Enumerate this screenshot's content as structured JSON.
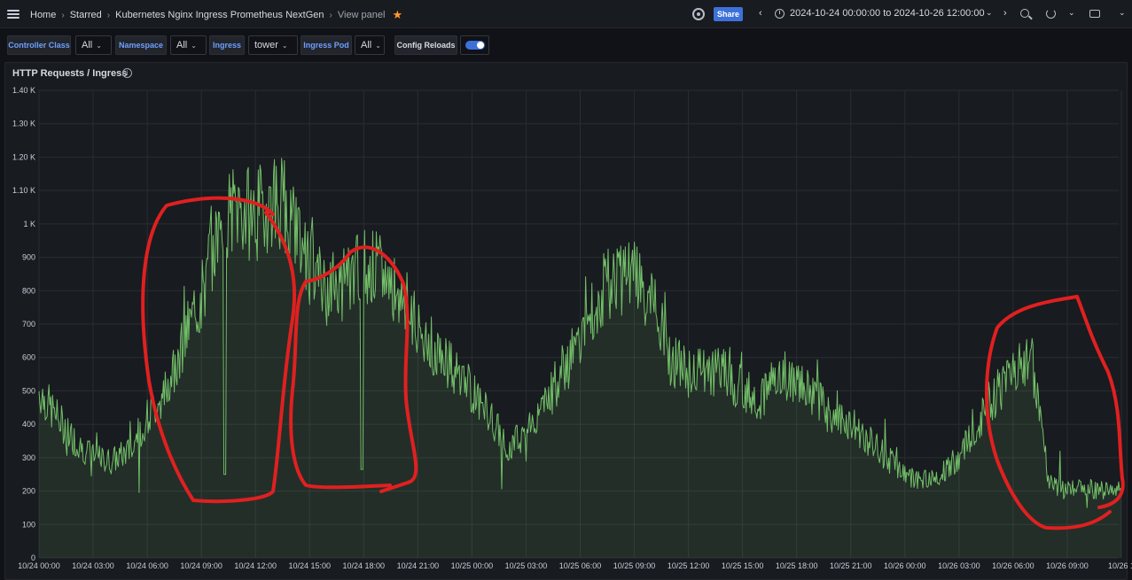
{
  "topbar": {
    "breadcrumbs": [
      "Home",
      "Starred",
      "Kubernetes Nginx Ingress Prometheus NextGen",
      "View panel"
    ],
    "share_label": "Share",
    "time_range": "2024-10-24 00:00:00 to 2024-10-26 12:00:00",
    "icons": [
      "menu-icon",
      "star-icon",
      "gear-icon",
      "time-back-icon",
      "clock-icon",
      "chevron-down-icon",
      "time-forward-icon",
      "zoom-out-icon",
      "refresh-icon",
      "chevron-down-icon",
      "tv-icon",
      "chevron-down-icon"
    ]
  },
  "variables": [
    {
      "label": "Controller Class",
      "value": "All"
    },
    {
      "label": "Namespace",
      "value": "All"
    },
    {
      "label": "Ingress",
      "value": "tower"
    },
    {
      "label": "Ingress Pod",
      "value": "All"
    },
    {
      "label": "Config Reloads",
      "toggle": true
    }
  ],
  "panel": {
    "title": "HTTP Requests / Ingress"
  },
  "colors": {
    "series": "#73bf69",
    "annotation": "#e02020",
    "accent": "#3d71d9",
    "star": "#ff9830"
  },
  "chart_data": {
    "type": "line",
    "title": "HTTP Requests / Ingress",
    "y_ticks": [
      "0",
      "100",
      "200",
      "300",
      "400",
      "500",
      "600",
      "700",
      "800",
      "900",
      "1 K",
      "1.10 K",
      "1.20 K",
      "1.30 K",
      "1.40 K"
    ],
    "ylim": [
      0,
      1400
    ],
    "x_ticks": [
      "10/24 00:00",
      "10/24 03:00",
      "10/24 06:00",
      "10/24 09:00",
      "10/24 12:00",
      "10/24 15:00",
      "10/24 18:00",
      "10/24 21:00",
      "10/25 00:00",
      "10/25 03:00",
      "10/25 06:00",
      "10/25 09:00",
      "10/25 12:00",
      "10/25 15:00",
      "10/25 18:00",
      "10/25 21:00",
      "10/26 00:00",
      "10/26 03:00",
      "10/26 06:00",
      "10/26 09:00",
      "10/26 1"
    ],
    "x_hours": [
      0,
      1,
      2,
      3,
      4,
      5,
      6,
      7,
      8,
      9,
      10,
      11,
      12,
      13,
      14,
      15,
      16,
      17,
      18,
      19,
      20,
      21,
      22,
      23,
      24,
      25,
      26,
      27,
      28,
      29,
      30,
      31,
      32,
      33,
      34,
      35,
      36,
      37,
      38,
      39,
      40,
      41,
      42,
      43,
      44,
      45,
      46,
      47,
      48,
      49,
      50,
      51,
      52,
      53,
      54,
      55,
      56,
      57,
      58,
      59,
      60
    ],
    "series": [
      {
        "values": [
          500,
          420,
          350,
          300,
          290,
          320,
          420,
          500,
          650,
          780,
          1000,
          1050,
          1020,
          1080,
          1050,
          880,
          800,
          830,
          880,
          850,
          800,
          680,
          620,
          560,
          500,
          420,
          330,
          380,
          450,
          560,
          640,
          780,
          850,
          830,
          760,
          600,
          550,
          560,
          560,
          500,
          480,
          560,
          520,
          480,
          420,
          400,
          350,
          300,
          250,
          230,
          250,
          300,
          400,
          480,
          580,
          600,
          220,
          200,
          210,
          200,
          210
        ],
        "color": "#73bf69"
      }
    ],
    "grid": true,
    "legend": "none",
    "annotations": [
      "red freehand circles around 10/24 06:00–13:30, 10/24 15:00–20:00 and 10/26 04:00–12:00"
    ]
  }
}
